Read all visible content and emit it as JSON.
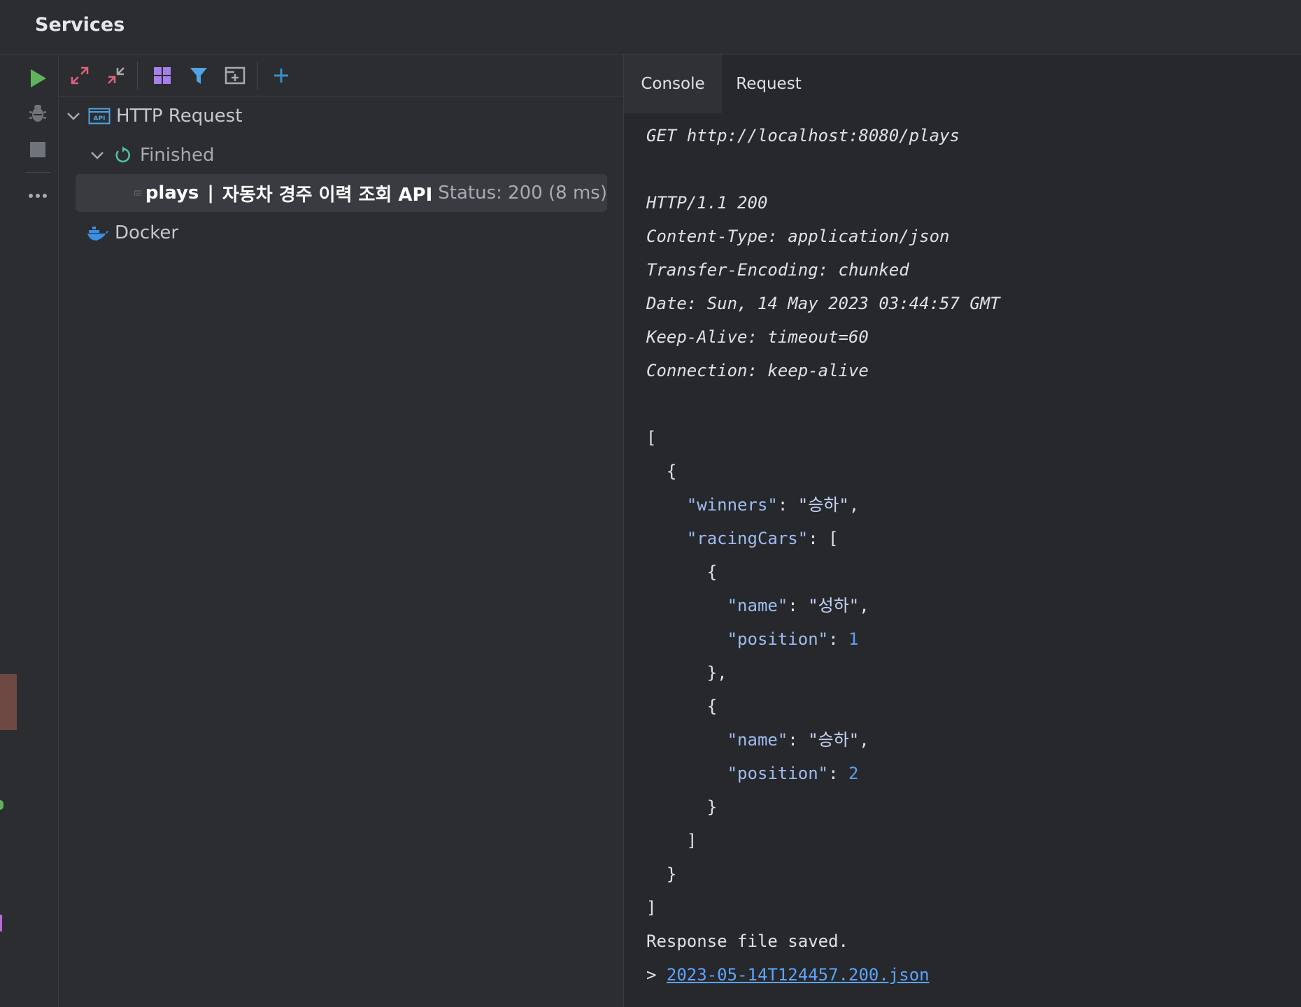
{
  "window": {
    "title": "Services"
  },
  "tree": {
    "root_label": "HTTP Request",
    "finished_label": "Finished",
    "request": {
      "name": "plays",
      "separator": "|",
      "description": "자동차 경주 이력 조회 API",
      "status": "Status: 200 (8 ms)"
    },
    "docker_label": "Docker"
  },
  "tabs": [
    {
      "label": "Console"
    },
    {
      "label": "Request"
    }
  ],
  "console": {
    "request_line": "GET http://localhost:8080/plays",
    "status_line": "HTTP/1.1 200",
    "headers": [
      "Content-Type: application/json",
      "Transfer-Encoding: chunked",
      "Date: Sun, 14 May 2023 03:44:57 GMT",
      "Keep-Alive: timeout=60",
      "Connection: keep-alive"
    ],
    "json": {
      "winners_key": "\"winners\"",
      "winners_value": "\"승하\"",
      "racing_key": "\"racingCars\"",
      "cars": [
        {
          "name_key": "\"name\"",
          "name": "\"성하\"",
          "position_key": "\"position\"",
          "position": "1"
        },
        {
          "name_key": "\"name\"",
          "name": "\"승하\"",
          "position_key": "\"position\"",
          "position": "2"
        }
      ]
    },
    "saved_text": "Response file saved.",
    "prompt": ">",
    "file_link": "2023-05-14T124457.200.json"
  },
  "colors": {
    "run": "#5fb35a",
    "accent": "#3592c4",
    "link": "#5ea3ff"
  }
}
